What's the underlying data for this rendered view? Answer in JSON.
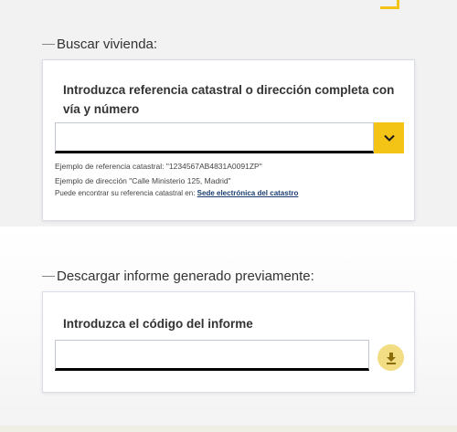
{
  "search_section": {
    "title": "Buscar vivienda:",
    "prompt": "Introduzca referencia catastral o dirección completa con vía y número",
    "input_value": "",
    "example_ref": "Ejemplo de referencia catastral: \"1234567AB4831A0091ZP\"",
    "example_address": "Ejemplo de dirección \"Calle Ministerio 125, Madrid\"",
    "find_ref_text": "Puede encontrar su referencia catastral en: ",
    "find_ref_link": "Sede electrónica del catastro",
    "select_icon": "chevron-down-icon"
  },
  "download_section": {
    "title": "Descargar informe generado previamente:",
    "prompt": "Introduzca el código del informe",
    "input_value": "",
    "download_icon": "download-icon"
  },
  "colors": {
    "accent": "#f3c316",
    "accent_light": "#f3dd84",
    "link": "#1a3c6e"
  }
}
